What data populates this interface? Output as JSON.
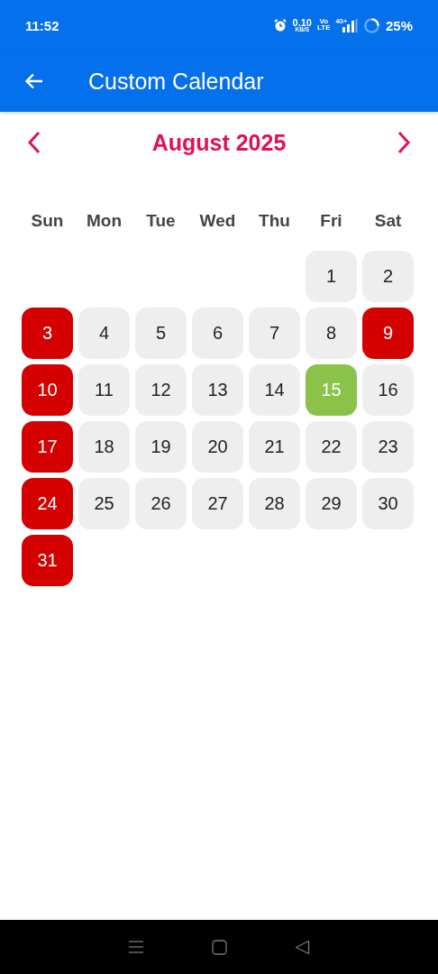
{
  "status_bar": {
    "time": "11:52",
    "speed": "0.10",
    "speed_unit": "KB/S",
    "volte_top": "Vo",
    "volte_bottom": "LTE",
    "network": "4G+",
    "battery": "25%"
  },
  "app_bar": {
    "title": "Custom Calendar"
  },
  "calendar": {
    "month": "August 2025",
    "weekdays": [
      "Sun",
      "Mon",
      "Tue",
      "Wed",
      "Thu",
      "Fri",
      "Sat"
    ],
    "weeks": [
      {
        "days": [
          {
            "label": "1",
            "kind": "normal"
          },
          {
            "label": "2",
            "kind": "normal"
          }
        ]
      },
      {
        "days": [
          {
            "label": "3",
            "kind": "holiday"
          },
          {
            "label": "4",
            "kind": "normal"
          },
          {
            "label": "5",
            "kind": "normal"
          },
          {
            "label": "6",
            "kind": "normal"
          },
          {
            "label": "7",
            "kind": "normal"
          },
          {
            "label": "8",
            "kind": "normal"
          },
          {
            "label": "9",
            "kind": "holiday"
          }
        ]
      },
      {
        "days": [
          {
            "label": "10",
            "kind": "holiday"
          },
          {
            "label": "11",
            "kind": "normal"
          },
          {
            "label": "12",
            "kind": "normal"
          },
          {
            "label": "13",
            "kind": "normal"
          },
          {
            "label": "14",
            "kind": "normal"
          },
          {
            "label": "15",
            "kind": "today"
          },
          {
            "label": "16",
            "kind": "normal"
          }
        ]
      },
      {
        "days": [
          {
            "label": "17",
            "kind": "holiday"
          },
          {
            "label": "18",
            "kind": "normal"
          },
          {
            "label": "19",
            "kind": "normal"
          },
          {
            "label": "20",
            "kind": "normal"
          },
          {
            "label": "21",
            "kind": "normal"
          },
          {
            "label": "22",
            "kind": "normal"
          },
          {
            "label": "23",
            "kind": "normal"
          }
        ]
      },
      {
        "days": [
          {
            "label": "24",
            "kind": "holiday"
          },
          {
            "label": "25",
            "kind": "normal"
          },
          {
            "label": "26",
            "kind": "normal"
          },
          {
            "label": "27",
            "kind": "normal"
          },
          {
            "label": "28",
            "kind": "normal"
          },
          {
            "label": "29",
            "kind": "normal"
          },
          {
            "label": "30",
            "kind": "normal"
          }
        ]
      },
      {
        "days": [
          {
            "label": "31",
            "kind": "holiday"
          }
        ]
      }
    ]
  }
}
